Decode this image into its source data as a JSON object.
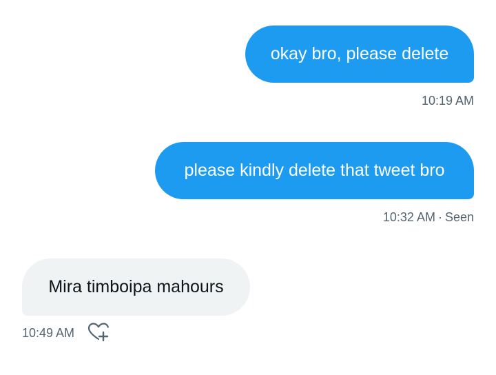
{
  "conversation": {
    "messages": [
      {
        "direction": "outgoing",
        "text": "okay bro, please delete",
        "time": "10:19 AM"
      },
      {
        "direction": "outgoing",
        "text": "please kindly delete that tweet bro",
        "time": "10:32 AM",
        "separator": "·",
        "status": "Seen"
      },
      {
        "direction": "incoming",
        "text": "Mira timboipa mahours",
        "time": "10:49 AM",
        "reaction_icon": "heart-plus-icon"
      }
    ]
  },
  "colors": {
    "outgoing_bubble": "#1d9bf0",
    "incoming_bubble": "#eff3f4",
    "meta_text": "#536471",
    "incoming_text": "#0f1419"
  }
}
